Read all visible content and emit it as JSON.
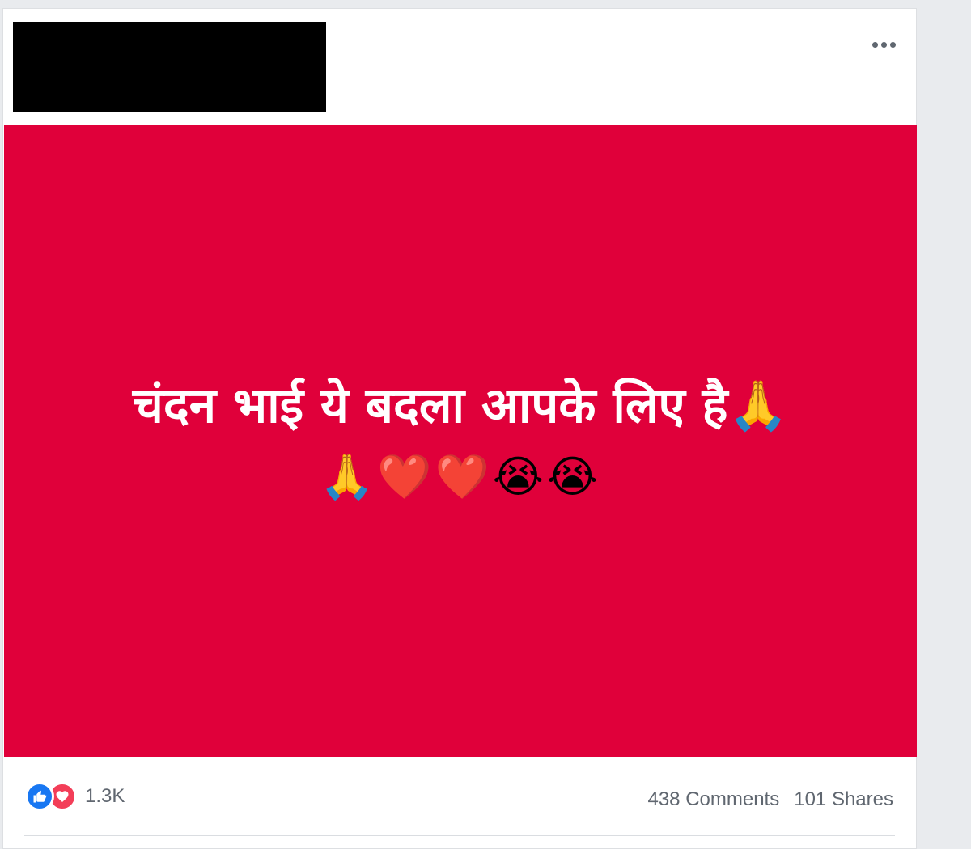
{
  "post": {
    "text": "चंदन भाई ये बदला आपके लिए है🙏",
    "emojis": "🙏❤️❤️😭😭",
    "background_color": "#e0003a",
    "text_color": "#ffffff"
  },
  "footer": {
    "reaction_icons": [
      "like-icon",
      "love-icon"
    ],
    "reaction_count": "1.3K",
    "comments": "438 Comments",
    "shares": "101 Shares"
  },
  "colors": {
    "like": "#1877f2",
    "love": "#f33e58",
    "meta_text": "#606770"
  }
}
